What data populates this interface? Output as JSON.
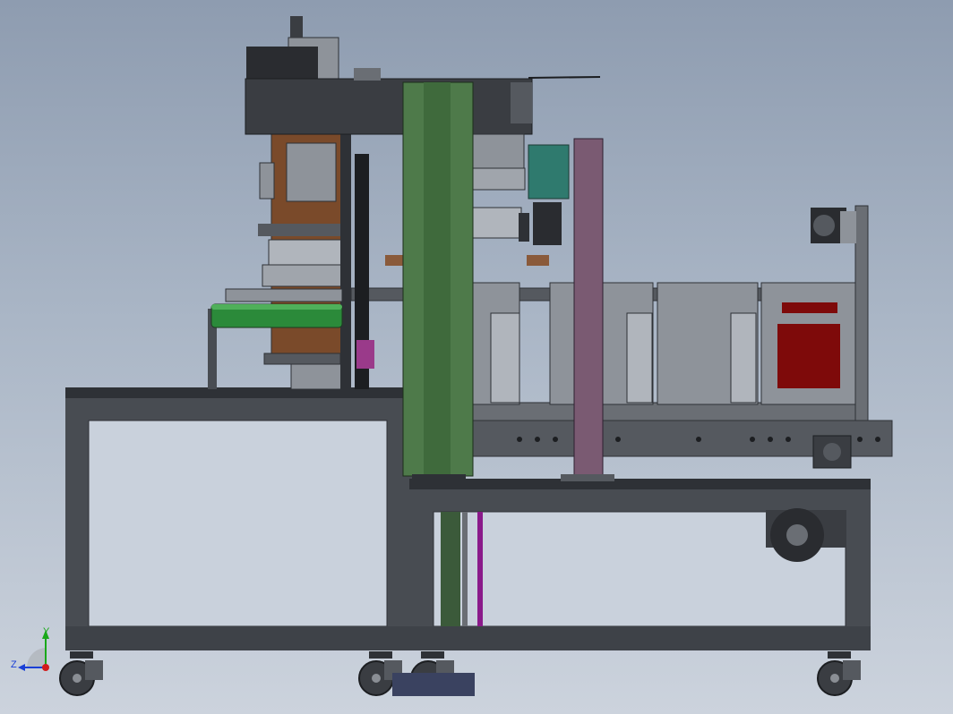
{
  "viewport": {
    "background_top": "#8e9cb0",
    "background_bottom": "#ccd3dd"
  },
  "triad": {
    "y_label": "Y",
    "z_label": "Z",
    "y_color": "#1aa81a",
    "z_color": "#1a3fd6",
    "x_color": "#d21c1c"
  },
  "colors": {
    "frame": "#484c52",
    "frame_dark": "#2e3136",
    "panel": "#c9d1dc",
    "green_column": "#4e7a4a",
    "mauve_column": "#7a5a72",
    "brown_block": "#7a4a2a",
    "red_panel": "#7e0a0a",
    "teal_motor": "#2f7a6e",
    "green_roller": "#2b8a3a",
    "magenta_block": "#9a3a8a"
  }
}
